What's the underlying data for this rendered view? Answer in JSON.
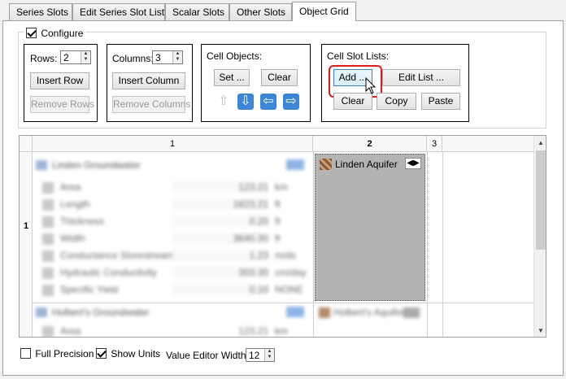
{
  "tabs": [
    "Series Slots",
    "Edit Series Slot List",
    "Scalar Slots",
    "Other Slots",
    "Object Grid"
  ],
  "configure": {
    "label": "Configure",
    "checked": true,
    "rows_label": "Rows:",
    "rows_value": "2",
    "insert_row": "Insert Row",
    "remove_rows": "Remove Rows",
    "columns_label": "Columns:",
    "columns_value": "3",
    "insert_column": "Insert Column",
    "remove_columns": "Remove Columns",
    "cell_objects_label": "Cell Objects:",
    "set_button": "Set ...",
    "clear_button": "Clear",
    "cell_slot_lists_label": "Cell Slot Lists:",
    "add_button": "Add ...",
    "edit_list_button": "Edit List ...",
    "clear_button_2": "Clear",
    "copy_button": "Copy",
    "paste_button": "Paste"
  },
  "grid": {
    "col_headers": [
      "1",
      "2",
      "3"
    ],
    "row_headers": [
      "1"
    ],
    "cell_1_1_title": "Linden Groundwater",
    "cell_1_1_slots": [
      "Area",
      "Length",
      "Thickness",
      "Width",
      "Conductance Storestream",
      "Hydraulic Conductivity",
      "Specific Yield"
    ],
    "cell_1_1_values": [
      "123.21",
      "1823.21",
      "0.20",
      "3640.30",
      "1.23",
      "303.30",
      "0.10"
    ],
    "cell_1_1_units": [
      "km",
      "ft",
      "ft",
      "ft",
      "m/ds",
      "cm/day",
      "NONE"
    ],
    "cell_1_2_title": "Linden Aquifer",
    "cell_2_1_title": "Holbert's Groundwater",
    "cell_2_1_slot": "Area",
    "cell_2_1_value": "123.21",
    "cell_2_1_unit": "km",
    "cell_2_2_title": "Holbert's Aquifer"
  },
  "footer": {
    "full_precision": "Full Precision",
    "full_precision_checked": false,
    "show_units": "Show Units",
    "show_units_checked": true,
    "value_editor_width_label": "Value Editor Width:",
    "value_editor_width": "12"
  }
}
